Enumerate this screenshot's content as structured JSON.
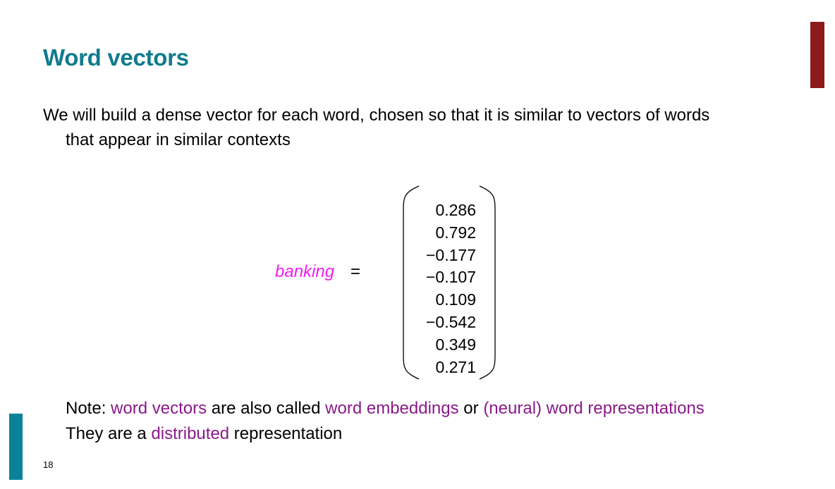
{
  "slide": {
    "title": "Word vectors",
    "intro_line1": "We will build a dense vector for each word, chosen so that it is similar to vectors of words",
    "intro_line2": "that appear in similar contexts",
    "equation": {
      "word": "banking",
      "equals": "=",
      "values": [
        "0.286",
        "0.792",
        "−0.177",
        "−0.107",
        "0.109",
        "−0.542",
        "0.349",
        "0.271"
      ]
    },
    "note": {
      "prefix": "Note: ",
      "term1": "word vectors",
      "mid1": " are also called ",
      "term2": "word embeddings",
      "mid2": " or ",
      "term3": "(neural) word representations",
      "line2_prefix": "They are a ",
      "term4": "distributed",
      "line2_suffix": " representation"
    },
    "page_number": "18"
  },
  "colors": {
    "title": "#117b8d",
    "word": "#f01cf0",
    "highlight": "#8a1a8a",
    "accent_top": "#8c1a1a",
    "accent_bottom": "#0a8299"
  }
}
